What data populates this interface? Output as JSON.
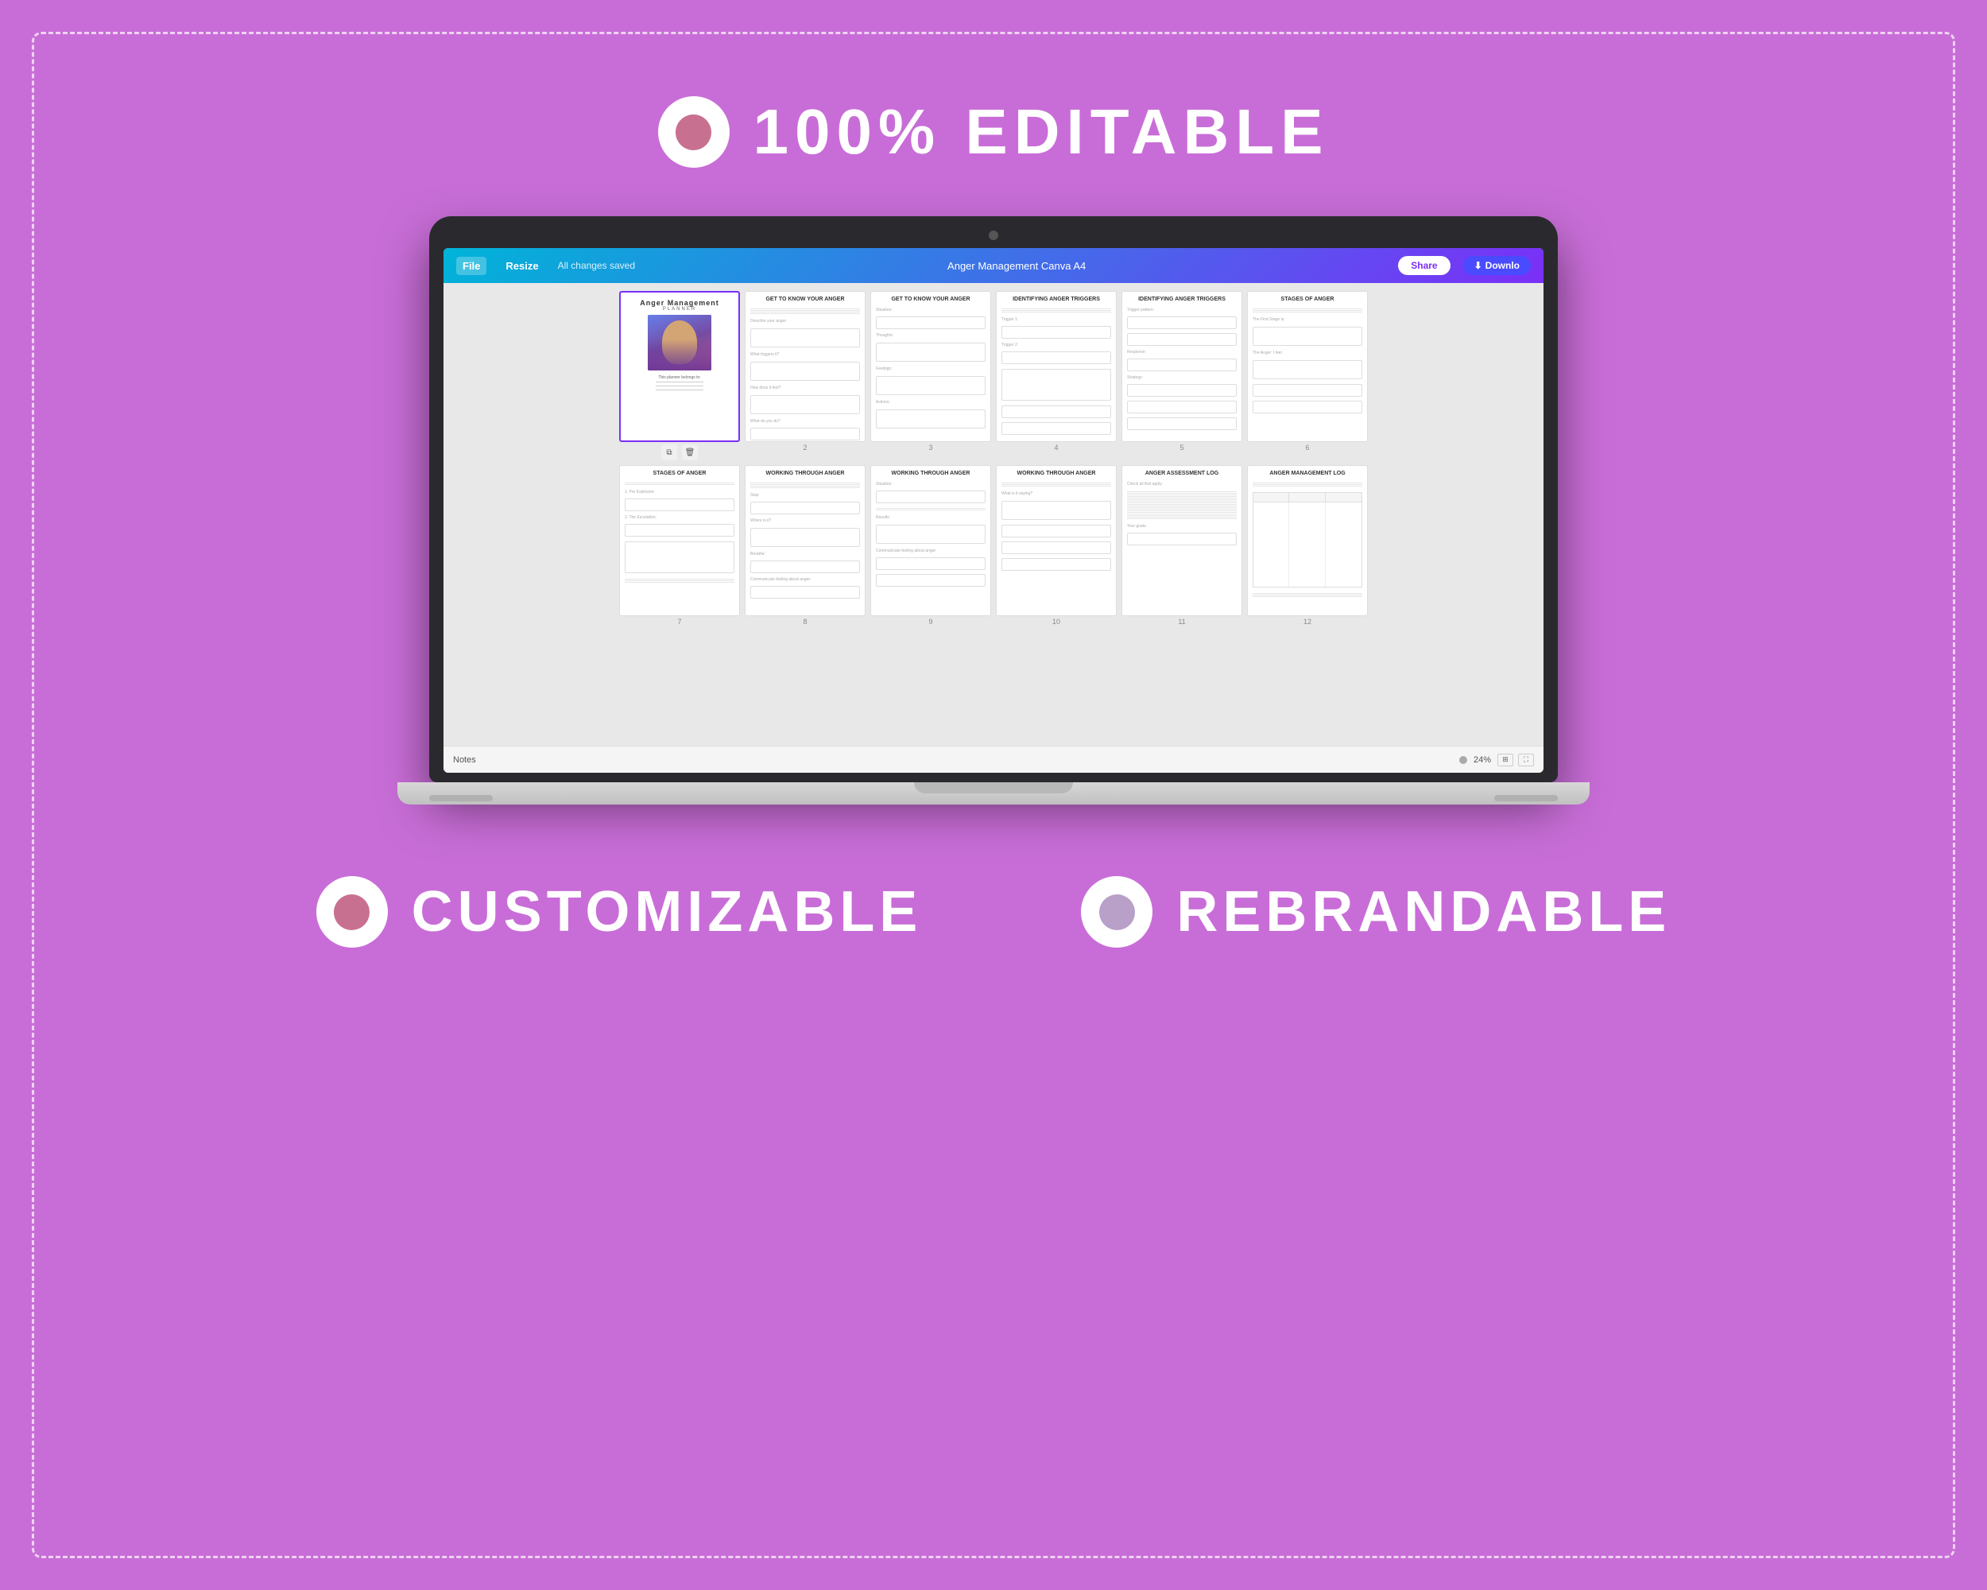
{
  "background_color": "#c86dd7",
  "border_color": "rgba(255,255,255,0.7)",
  "top_badge": {
    "label": "100% EDITABLE"
  },
  "bottom_badges": [
    {
      "label": "CUSTOMIZABLE"
    },
    {
      "label": "REBRANDABLE"
    }
  ],
  "toolbar": {
    "file_label": "File",
    "resize_label": "Resize",
    "saved_label": "All changes saved",
    "title": "Anger Management Canva A4",
    "share_label": "Share",
    "download_label": "Downlo"
  },
  "bottom_bar": {
    "notes_label": "Notes",
    "zoom": "24%"
  },
  "pages_row1": [
    {
      "num": "",
      "type": "cover",
      "title": "Anger Management",
      "subtitle": "PLANNER"
    },
    {
      "num": "2",
      "type": "worksheet",
      "title": "GET TO KNOW YOUR ANGER"
    },
    {
      "num": "3",
      "type": "worksheet",
      "title": "GET TO KNOW YOUR ANGER"
    },
    {
      "num": "4",
      "type": "worksheet",
      "title": "IDENTIFYING ANGER TRIGGERS"
    },
    {
      "num": "5",
      "type": "worksheet",
      "title": "IDENTIFYING ANGER TRIGGERS"
    },
    {
      "num": "6",
      "type": "worksheet",
      "title": "STAGES OF ANGER"
    }
  ],
  "pages_row2": [
    {
      "num": "7",
      "type": "worksheet",
      "title": "STAGES OF ANGER"
    },
    {
      "num": "8",
      "type": "worksheet",
      "title": "WORKING THROUGH ANGER"
    },
    {
      "num": "9",
      "type": "worksheet",
      "title": "WORKING THROUGH ANGER"
    },
    {
      "num": "10",
      "type": "worksheet",
      "title": "WORKING THROUGH ANGER"
    },
    {
      "num": "11",
      "type": "worksheet",
      "title": "ANGER ASSESSMENT LOG"
    },
    {
      "num": "12",
      "type": "worksheet",
      "title": "ANGER MANAGEMENT LOG"
    }
  ]
}
